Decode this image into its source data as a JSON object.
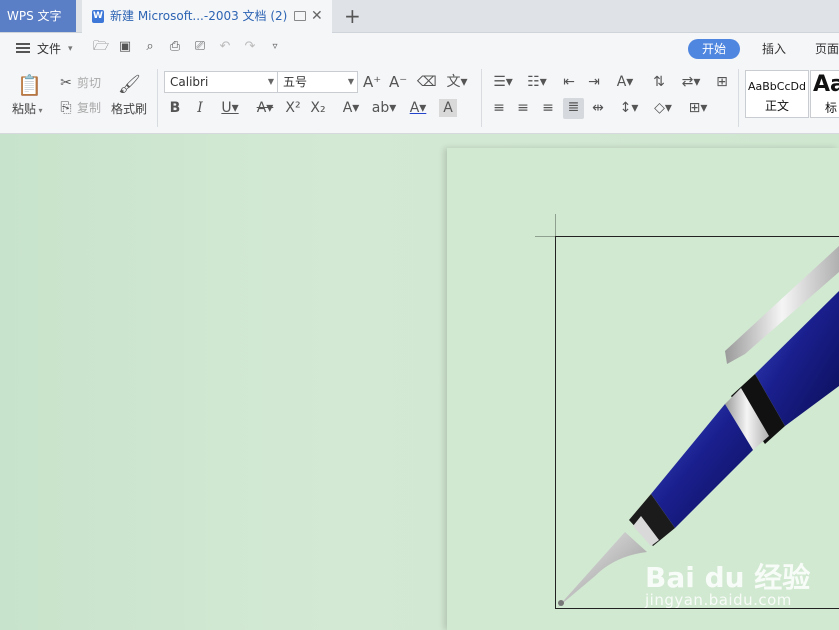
{
  "titlebar": {
    "app_tab": "WPS 文字",
    "doc_tab": "新建 Microsoft...-2003 文档 (2)",
    "doc_icon": "W",
    "close": "✕",
    "new_tab": "+"
  },
  "menu": {
    "file": "文件",
    "tabs": [
      "开始",
      "插入",
      "页面"
    ]
  },
  "clipboard": {
    "paste": "粘贴",
    "cut": "剪切",
    "copy": "复制",
    "format_painter": "格式刷"
  },
  "font": {
    "name": "Calibri",
    "size": "五号"
  },
  "styles": {
    "normal_preview": "AaBbCcDd",
    "normal_label": "正文",
    "heading_preview": "Aa",
    "heading_label": "标"
  },
  "watermark": {
    "brand": "Bai du 经验",
    "url": "jingyan.baidu.com"
  },
  "colors": {
    "accent": "#4f86e0",
    "app_tab": "#5b7fc6",
    "workspace": "#cfe6d0"
  }
}
